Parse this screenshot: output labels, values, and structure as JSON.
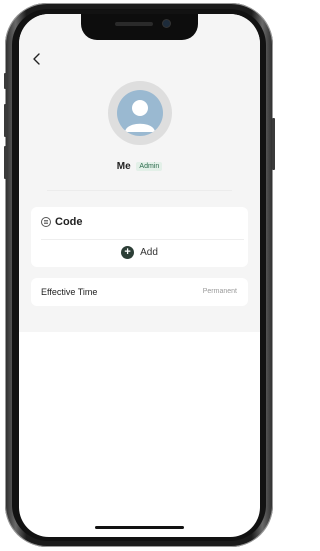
{
  "nav": {
    "back_icon": "chevron-left-icon"
  },
  "profile": {
    "avatar_icon": "user-avatar-icon",
    "name": "Me",
    "role_badge": "Admin"
  },
  "code_section": {
    "title": "Code",
    "icon": "code-icon",
    "add_label": "Add",
    "add_icon": "plus-icon"
  },
  "effective_time": {
    "label": "Effective Time",
    "value": "Permanent"
  },
  "colors": {
    "badge_text": "#2d6b4d",
    "badge_bg": "#e3f0e8",
    "add_button": "#2c3e36",
    "avatar_bg": "#9ab9d1",
    "page_bg": "#f5f5f5"
  }
}
